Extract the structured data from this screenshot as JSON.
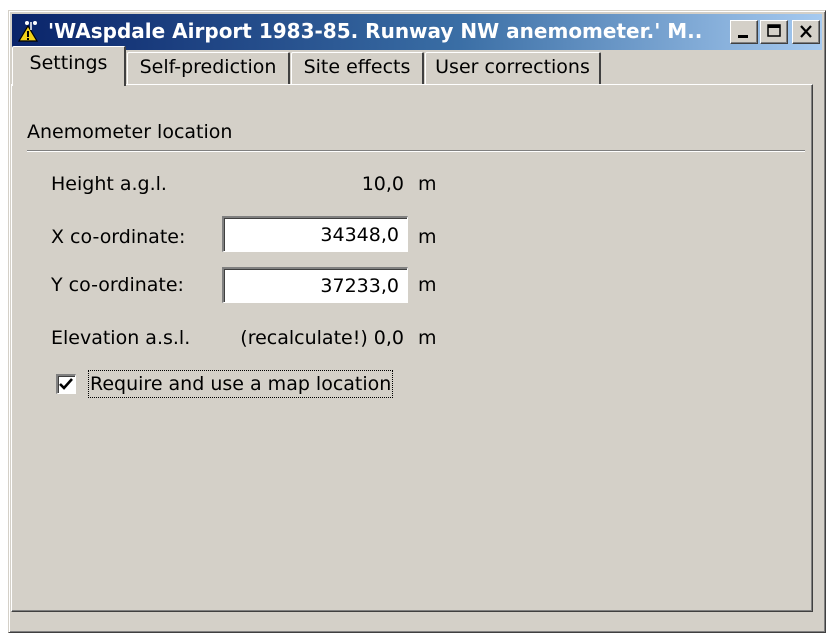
{
  "window": {
    "title": "'WAspdale Airport 1983-85. Runway NW anemometer.' M...",
    "icon": "anemometer-warning-icon"
  },
  "titlebar_buttons": {
    "minimize_icon": "minimize-icon",
    "maximize_icon": "maximize-icon",
    "close_icon": "close-icon"
  },
  "tabs": [
    {
      "label": "Settings",
      "active": true
    },
    {
      "label": "Self-prediction",
      "active": false
    },
    {
      "label": "Site effects",
      "active": false
    },
    {
      "label": "User corrections",
      "active": false
    }
  ],
  "settings": {
    "group_title": "Anemometer location",
    "height": {
      "label": "Height a.g.l.",
      "value": "10,0",
      "unit": "m"
    },
    "x_coord": {
      "label": "X co-ordinate:",
      "value": "34348,0",
      "unit": "m"
    },
    "y_coord": {
      "label": "Y co-ordinate:",
      "value": "37233,0",
      "unit": "m"
    },
    "elevation": {
      "label": "Elevation a.s.l.",
      "value": "(recalculate!) 0,0",
      "unit": "m"
    },
    "map_location": {
      "label": "Require and use a map location",
      "checked": true
    }
  }
}
